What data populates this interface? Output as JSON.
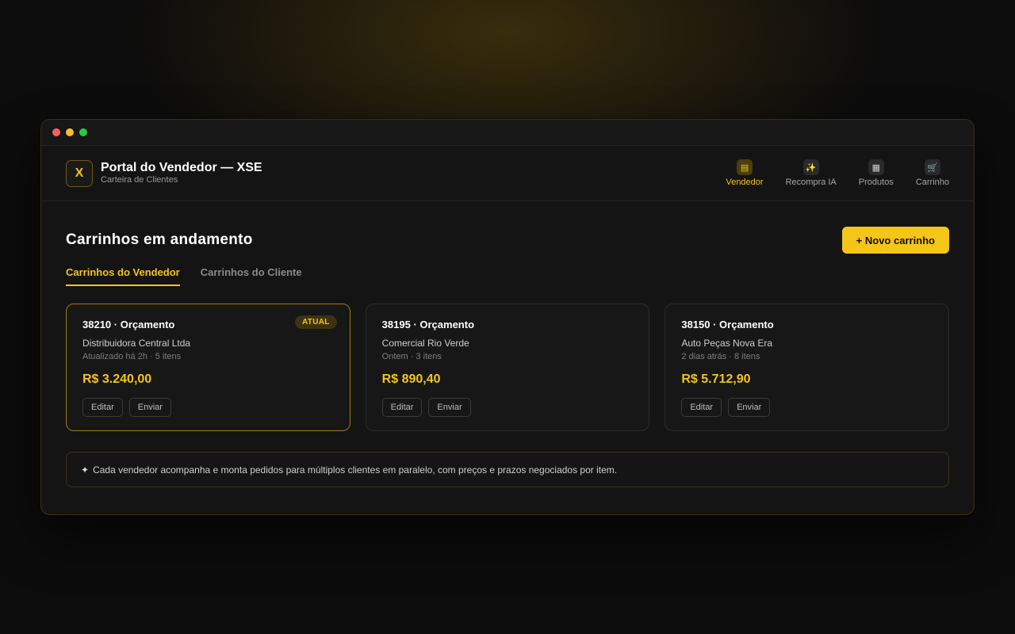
{
  "window": {
    "controls": {
      "close_color": "#ff5f57",
      "minimize_color": "#febc2e",
      "maximize_color": "#28c840"
    }
  },
  "header": {
    "logo_letter": "X",
    "title": "Portal do Vendedor — XSE",
    "subtitle": "Carteira de Clientes",
    "nav": [
      {
        "label": "Vendedor",
        "icon": "document-icon",
        "glyph": "▤",
        "active": true
      },
      {
        "label": "Recompra IA",
        "icon": "sparkles-icon",
        "glyph": "✨",
        "active": false
      },
      {
        "label": "Produtos",
        "icon": "grid-icon",
        "glyph": "▦",
        "active": false
      },
      {
        "label": "Carrinho",
        "icon": "cart-icon",
        "glyph": "🛒",
        "active": false
      }
    ]
  },
  "main": {
    "title": "Carrinhos em andamento",
    "new_button": "+ Novo carrinho",
    "tabs": [
      {
        "label": "Carrinhos do Vendedor",
        "active": true
      },
      {
        "label": "Carrinhos do Cliente",
        "active": false
      }
    ],
    "carts": [
      {
        "title": "38210 · Orçamento",
        "badge": "ATUAL",
        "client": "Distribuidora Central Ltda",
        "meta": "Atualizado há 2h · 5 itens",
        "total": "R$ 3.240,00",
        "edit": "Editar",
        "send": "Enviar"
      },
      {
        "title": "38195 · Orçamento",
        "client": "Comercial Rio Verde",
        "meta": "Ontem · 3 itens",
        "total": "R$ 890,40",
        "edit": "Editar",
        "send": "Enviar"
      },
      {
        "title": "38150 · Orçamento",
        "client": "Auto Peças Nova Era",
        "meta": "2 dias atrás · 8 itens",
        "total": "R$ 5.712,90",
        "edit": "Editar",
        "send": "Enviar"
      }
    ],
    "note": {
      "icon": "✦",
      "text": "Cada vendedor acompanha e monta pedidos para múltiplos clientes em paralelo, com preços e prazos negociados por item."
    }
  },
  "colors": {
    "accent": "#f5c518",
    "background": "#141414"
  }
}
